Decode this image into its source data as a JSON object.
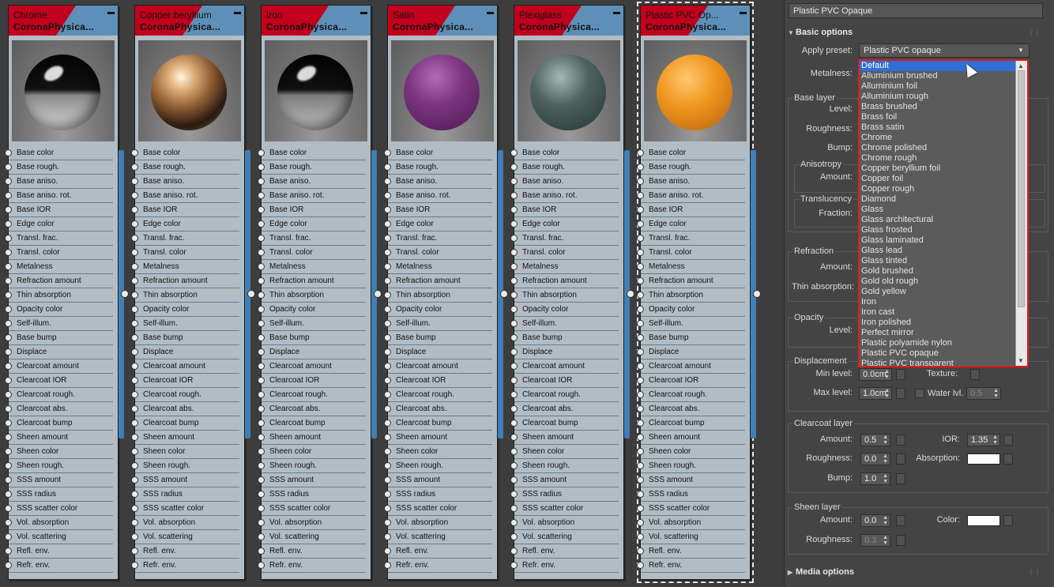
{
  "nodes": [
    {
      "name": "Chrome",
      "type": "CoronaPhysica...",
      "sphere": "sph-chrome",
      "highlight": true
    },
    {
      "name": "Copper beryllium",
      "type": "CoronaPhysica...",
      "sphere": "sph-copper",
      "highlight": false
    },
    {
      "name": "Iron",
      "type": "CoronaPhysica...",
      "sphere": "sph-iron",
      "highlight": true
    },
    {
      "name": "Satin",
      "type": "CoronaPhysica...",
      "sphere": "sph-satin",
      "highlight": false
    },
    {
      "name": "Plexiglass",
      "type": "CoronaPhysica...",
      "sphere": "sph-plexi",
      "highlight": false
    },
    {
      "name": "Plastic PVC Op...",
      "type": "CoronaPhysica...",
      "sphere": "sph-pvc",
      "highlight": false
    }
  ],
  "slots": [
    "Base color",
    "Base rough.",
    "Base aniso.",
    "Base aniso. rot.",
    "Base IOR",
    "Edge color",
    "Transl. frac.",
    "Transl. color",
    "Metalness",
    "Refraction amount",
    "Thin absorption",
    "Opacity color",
    "Self-illum.",
    "Base bump",
    "Displace",
    "Clearcoat amount",
    "Clearcoat IOR",
    "Clearcoat rough.",
    "Clearcoat abs.",
    "Clearcoat bump",
    "Sheen amount",
    "Sheen color",
    "Sheen rough.",
    "SSS amount",
    "SSS radius",
    "SSS scatter color",
    "Vol. absorption",
    "Vol. scattering",
    "Refl. env.",
    "Refr. env."
  ],
  "panel": {
    "material_name": "Plastic PVC Opaque",
    "basic_options": "Basic options",
    "apply_preset_label": "Apply preset:",
    "apply_preset_value": "Plastic PVC opaque",
    "metalness_label": "Metalness:",
    "base_layer": "Base layer",
    "level_label": "Level:",
    "roughness_label": "Roughness:",
    "bump_label": "Bump:",
    "anisotropy": "Anisotropy",
    "amount_label": "Amount:",
    "translucency": "Translucency",
    "fraction_label": "Fraction:",
    "refraction": "Refraction",
    "thin_absorption_label": "Thin absorption:",
    "opacity": "Opacity",
    "displacement": "Displacement",
    "min_level_label": "Min level:",
    "min_level_value": "0.0cm",
    "max_level_label": "Max level:",
    "max_level_value": "1.0cm",
    "texture_label": "Texture:",
    "water_lvl_label": "Water lvl.",
    "water_lvl_value": "0.5",
    "clearcoat_layer": "Clearcoat layer",
    "cc_amount_value": "0.5",
    "ior_label": "IOR:",
    "ior_value": "1.35",
    "cc_roughness_value": "0.0",
    "absorption_label": "Absorption:",
    "cc_bump_value": "1.0",
    "sheen_layer": "Sheen layer",
    "sheen_amount_value": "0.0",
    "color_label": "Color:",
    "sheen_roughness_value": "0.3",
    "media_options": "Media options"
  },
  "dropdown_items": [
    "Default",
    "Alluminium brushed",
    "Alluminium foil",
    "Alluminium rough",
    "Brass brushed",
    "Brass foil",
    "Brass satin",
    "Chrome",
    "Chrome polished",
    "Chrome rough",
    "Copper beryllium foil",
    "Copper foil",
    "Copper rough",
    "Diamond",
    "Glass",
    "Glass architectural",
    "Glass frosted",
    "Glass laminated",
    "Glass lead",
    "Glass tinted",
    "Gold brushed",
    "Gold old rough",
    "Gold yellow",
    "Iron",
    "Iron cast",
    "Iron polished",
    "Perfect mirror",
    "Plastic polyamide nylon",
    "Plastic PVC opaque",
    "Plastic PVC transparent"
  ],
  "dropdown_selected": "Default",
  "colors": {
    "node_header_red": "#c1001d",
    "node_header_blue": "#5e8fb8",
    "dropdown_border": "#e31b1b",
    "selection": "#2f6fd6"
  }
}
